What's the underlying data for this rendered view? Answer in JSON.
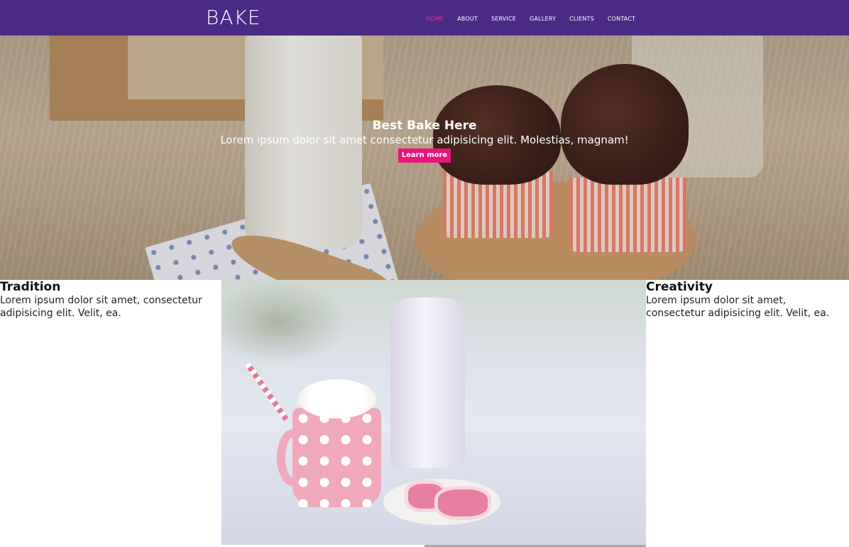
{
  "brand": {
    "name": "BAKE"
  },
  "nav": {
    "items": [
      {
        "label": "HOME",
        "active": true
      },
      {
        "label": "ABOUT",
        "active": false
      },
      {
        "label": "SERVICE",
        "active": false
      },
      {
        "label": "GALLERY",
        "active": false
      },
      {
        "label": "CLIENTS",
        "active": false
      },
      {
        "label": "CONTACT",
        "active": false
      }
    ]
  },
  "hero": {
    "title": "Best Bake Here",
    "subtitle": "Lorem ipsum dolor sit amet consectetur adipisicing elit. Molestias, magnam!",
    "button_label": "Learn more"
  },
  "features": {
    "left": {
      "title": "Tradition",
      "text": "Lorem ipsum dolor sit amet, consectetur adipisicing elit. Velit, ea."
    },
    "right": {
      "title": "Creativity",
      "text": "Lorem ipsum dolor sit amet, consectetur adipisicing elit. Velit, ea."
    }
  },
  "colors": {
    "navbar": "#4b2a86",
    "accent": "#e8157a",
    "nav_active": "#e8357d"
  }
}
